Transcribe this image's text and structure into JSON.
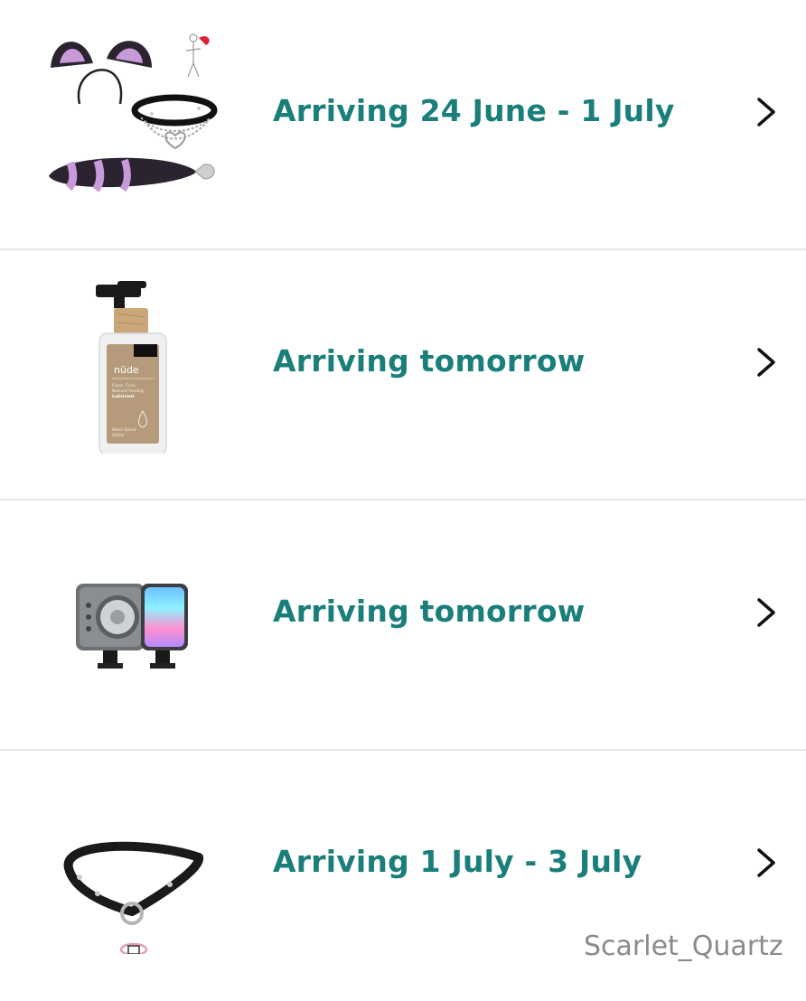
{
  "orders": [
    {
      "status": "Arriving 24 June - 1 July",
      "image": "cat-ears-choker-tail-set",
      "chevron_icon": "chevron-right-icon"
    },
    {
      "status": "Arriving tomorrow",
      "image": "nude-lubricant-bottle",
      "image_text": {
        "brand": "nüde",
        "line1": "Clear, Cool,",
        "line2": "Natural Feeling",
        "line3": "Lubricant",
        "line4": "Water Based",
        "line5": "200ml"
      },
      "chevron_icon": "chevron-right-icon"
    },
    {
      "status": "Arriving tomorrow",
      "image": "rgb-camera-led-light",
      "chevron_icon": "chevron-right-icon"
    },
    {
      "status": "Arriving 1 July - 3 July",
      "image": "o-ring-strap-gag",
      "chevron_icon": "chevron-right-icon"
    }
  ],
  "watermark": "Scarlet_Quartz",
  "colors": {
    "status_text": "#1a7f7a",
    "divider": "#e3e6e6",
    "chevron": "#111111",
    "watermark": "#8a8a8a"
  }
}
